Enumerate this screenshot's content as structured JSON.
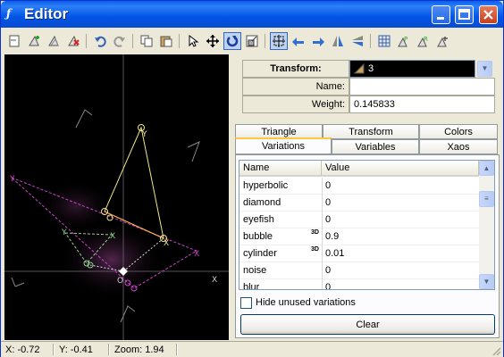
{
  "window": {
    "title": "Editor",
    "icon": "fractal-f-icon"
  },
  "toolbar": {
    "icons": [
      "new-icon",
      "add-icon",
      "duplicate-icon",
      "delete-icon",
      "undo-icon",
      "redo-icon",
      "copy-icon",
      "paste-icon",
      "select-icon",
      "move-icon",
      "rotate-icon",
      "scale-icon",
      "pivot-icon",
      "rotate-left-icon",
      "rotate-right-icon",
      "flip-horizontal-icon",
      "flip-vertical-icon",
      "grid-icon",
      "post-transform-icon",
      "reset-icon",
      "reset-all-icon"
    ]
  },
  "transform": {
    "label": "Transform:",
    "value": "3",
    "name_label": "Name:",
    "name_value": "",
    "weight_label": "Weight:",
    "weight_value": "0.145833"
  },
  "tabs": {
    "row1": [
      "Triangle",
      "Transform",
      "Colors"
    ],
    "row2": [
      "Variations",
      "Variables",
      "Xaos"
    ],
    "selected": "Variations"
  },
  "variations": {
    "col_name": "Name",
    "col_value": "Value",
    "rows": [
      {
        "name": "hyperbolic",
        "value": "0",
        "flag": ""
      },
      {
        "name": "diamond",
        "value": "0",
        "flag": ""
      },
      {
        "name": "eyefish",
        "value": "0",
        "flag": ""
      },
      {
        "name": "bubble",
        "value": "0.9",
        "flag": "3D"
      },
      {
        "name": "cylinder",
        "value": "0.01",
        "flag": "3D"
      },
      {
        "name": "noise",
        "value": "0",
        "flag": ""
      },
      {
        "name": "blur",
        "value": "0",
        "flag": ""
      }
    ],
    "hide_unused_label": "Hide unused variations",
    "hide_unused_checked": false,
    "clear_label": "Clear"
  },
  "triangles": {
    "vertex_labels": [
      "Y",
      "X",
      "O",
      "Y",
      "X"
    ]
  },
  "status": {
    "x": "X: -0.72",
    "y": "Y: -0.41",
    "zoom": "Zoom: 1.94"
  },
  "colors": {
    "title_bar": "#0a5fe8",
    "selected_triangle": "#f0e68c",
    "other_triangle": "#cc44cc",
    "reference_triangle": "#8fd18f"
  }
}
